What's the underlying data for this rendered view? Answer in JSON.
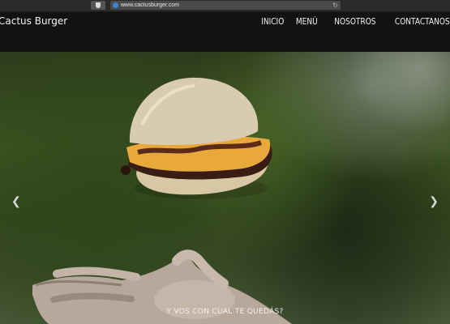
{
  "browser": {
    "url": "www.cactusburger.com",
    "icons": [
      "shield-icon",
      "globe-icon",
      "reload-icon"
    ]
  },
  "header": {
    "brand": "Cactus Burger",
    "nav": [
      "INICIO",
      "MENÚ",
      "NOSOTROS",
      "CONTACTANOS"
    ]
  },
  "hero": {
    "tagline": "Y VOS CON CUAL TE QUEDÁS?",
    "prev_symbol": "❮",
    "next_symbol": "❯"
  },
  "colors": {
    "header_bg": "#121212",
    "bun": "#d8c7a4",
    "cheese": "#e9a83a",
    "foliage": "#3f5522"
  }
}
